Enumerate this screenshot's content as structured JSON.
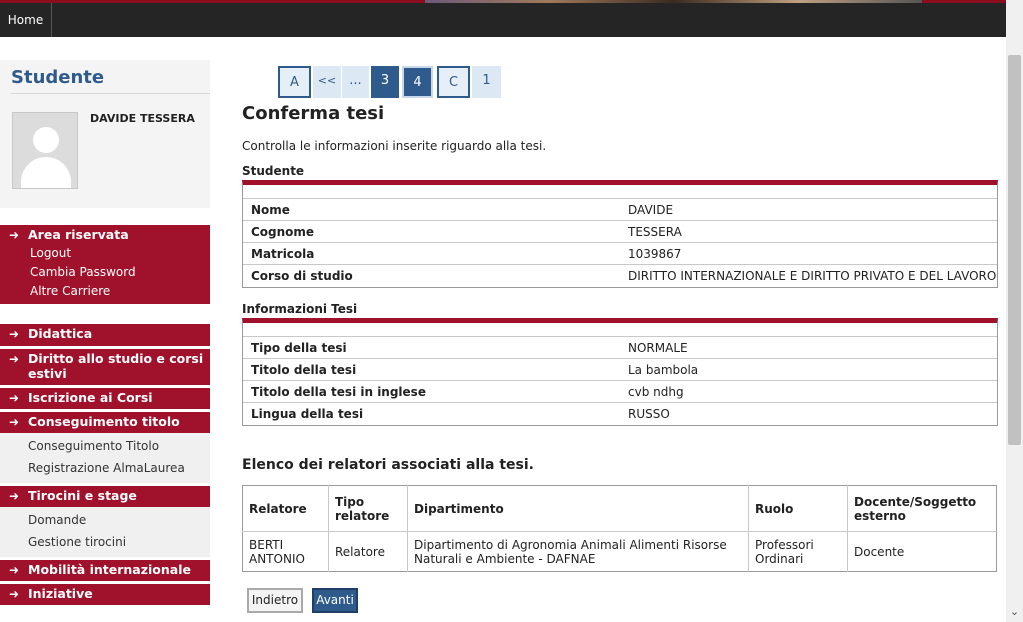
{
  "topbar": {
    "home_label": "Home"
  },
  "sidebar": {
    "student_title": "Studente",
    "student_name": "DAVIDE TESSERA",
    "area_riservata": {
      "label": "Area riservata",
      "items": [
        "Logout",
        "Cambia Password",
        "Altre Carriere"
      ]
    },
    "menu": [
      {
        "label": "Didattica"
      },
      {
        "label": "Diritto allo studio e corsi estivi"
      },
      {
        "label": "Iscrizione ai Corsi"
      },
      {
        "label": "Conseguimento titolo",
        "items": [
          "Conseguimento Titolo",
          "Registrazione AlmaLaurea"
        ]
      },
      {
        "label": "Tirocini e stage",
        "items": [
          "Domande",
          "Gestione tirocini"
        ]
      },
      {
        "label": "Mobilità internazionale"
      },
      {
        "label": "Iniziative"
      }
    ]
  },
  "pager": {
    "steps": [
      "A",
      "<<",
      "...",
      "3",
      "4",
      "C",
      "1"
    ]
  },
  "main": {
    "title": "Conferma tesi",
    "intro": "Controlla le informazioni inserite riguardo alla tesi.",
    "student_section": {
      "label": "Studente",
      "rows": [
        {
          "key": "Nome",
          "value": "DAVIDE"
        },
        {
          "key": "Cognome",
          "value": "TESSERA"
        },
        {
          "key": "Matricola",
          "value": "1039867"
        },
        {
          "key": "Corso di studio",
          "value": "DIRITTO INTERNAZIONALE E DIRITTO PRIVATO E DEL LAVORO"
        }
      ]
    },
    "thesis_section": {
      "label": "Informazioni Tesi",
      "rows": [
        {
          "key": "Tipo della tesi",
          "value": "NORMALE"
        },
        {
          "key": "Titolo della tesi",
          "value": "La bambola"
        },
        {
          "key": "Titolo della tesi in inglese",
          "value": "cvb ndhg"
        },
        {
          "key": "Lingua della tesi",
          "value": "RUSSO"
        }
      ]
    },
    "relatori": {
      "title": "Elenco dei relatori associati alla tesi.",
      "headers": [
        "Relatore",
        "Tipo relatore",
        "Dipartimento",
        "Ruolo",
        "Docente/Soggetto esterno"
      ],
      "rows": [
        [
          "BERTI ANTONIO",
          "Relatore",
          "Dipartimento di Agronomia Animali Alimenti Risorse Naturali e Ambiente - DAFNAE",
          "Professori Ordinari",
          "Docente"
        ]
      ]
    },
    "buttons": {
      "back": "Indietro",
      "next": "Avanti"
    }
  },
  "colors": {
    "accent_red": "#a0112b",
    "accent_blue": "#2f5b8c"
  }
}
